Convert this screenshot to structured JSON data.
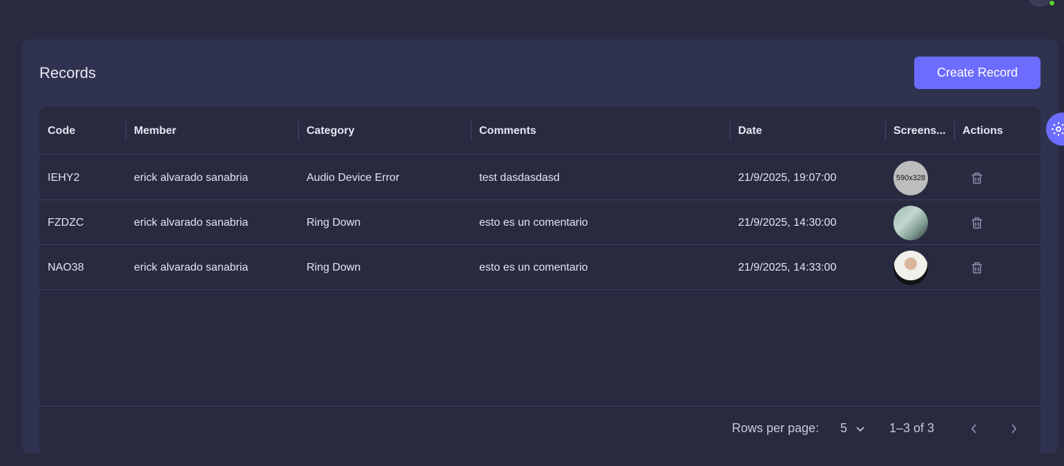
{
  "page": {
    "title": "Records",
    "create_button": "Create Record"
  },
  "table": {
    "columns": [
      "Code",
      "Member",
      "Category",
      "Comments",
      "Date",
      "Screens...",
      "Actions"
    ],
    "rows": [
      {
        "code": "IEHY2",
        "member": "erick alvarado sanabria",
        "category": "Audio Device Error",
        "comments": "test dasdasdasd",
        "date": "21/9/2025, 19:07:00",
        "screenshot": "590x328",
        "screenshot_kind": "placeholder"
      },
      {
        "code": "FZDZC",
        "member": "erick alvarado sanabria",
        "category": "Ring Down",
        "comments": "esto es un comentario",
        "date": "21/9/2025, 14:30:00",
        "screenshot": "",
        "screenshot_kind": "screen"
      },
      {
        "code": "NAO38",
        "member": "erick alvarado sanabria",
        "category": "Ring Down",
        "comments": "esto es un comentario",
        "date": "21/9/2025, 14:33:00",
        "screenshot": "",
        "screenshot_kind": "person"
      }
    ]
  },
  "pagination": {
    "rows_per_page_label": "Rows per page:",
    "rows_per_page_value": "5",
    "range_label": "1–3 of 3"
  },
  "icons": {
    "delete": "trash-icon",
    "settings": "gear-icon",
    "dropdown": "chevron-down-icon",
    "prev": "chevron-left-icon",
    "next": "chevron-right-icon"
  },
  "colors": {
    "background": "#282a40",
    "panel": "#303350",
    "accent": "#6c6cff",
    "online": "#5ad02e"
  }
}
